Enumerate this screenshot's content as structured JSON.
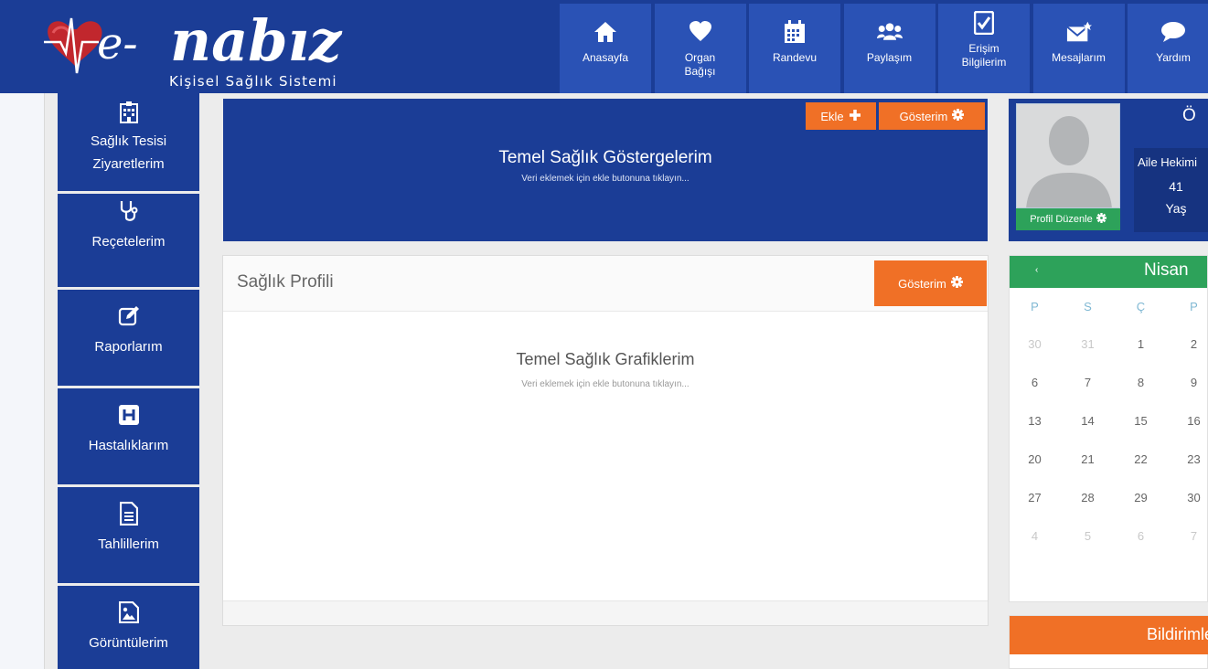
{
  "header": {
    "logo_text": "e-nabız",
    "logo_tagline": "Kişisel Sağlık Sistemi",
    "nav": [
      {
        "label": "Anasayfa",
        "icon": "home-icon"
      },
      {
        "label": "Organ Bağışı",
        "icon": "heart-icon"
      },
      {
        "label": "Randevu",
        "icon": "calendar-icon"
      },
      {
        "label": "Paylaşım",
        "icon": "users-icon"
      },
      {
        "label": "Erişim Bilgilerim",
        "icon": "checkbox-icon"
      },
      {
        "label": "Mesajlarım",
        "icon": "envelope-icon"
      },
      {
        "label": "Yardım",
        "icon": "chat-bubble-icon"
      }
    ]
  },
  "sidebar": {
    "items": [
      {
        "label": "Sağlık Tesisi Ziyaretlerim",
        "icon": "hospital-building-icon"
      },
      {
        "label": "Reçetelerim",
        "icon": "stethoscope-icon"
      },
      {
        "label": "Raporlarım",
        "icon": "edit-icon"
      },
      {
        "label": "Hastalıklarım",
        "icon": "h-square-icon"
      },
      {
        "label": "Tahlillerim",
        "icon": "document-icon"
      },
      {
        "label": "Görüntülerim",
        "icon": "image-icon"
      }
    ]
  },
  "temel": {
    "add_label": "Ekle",
    "view_label": "Gösterim",
    "title": "Temel Sağlık Göstergelerim",
    "subtitle": "Veri eklemek için ekle butonuna tıklayın..."
  },
  "profil": {
    "title": "Sağlık Profili",
    "view_label": "Gösterim",
    "graph_title": "Temel Sağlık Grafiklerim",
    "graph_subtitle": "Veri eklemek için ekle butonuna tıklayın..."
  },
  "user": {
    "initial": "Ö",
    "edit_label": "Profil Düzenle",
    "doctor_label": "Aile Hekimi",
    "age": "41",
    "age_label": "Yaş"
  },
  "calendar": {
    "prev": "‹",
    "month": "Nisan",
    "days_of_week": [
      "P",
      "S",
      "Ç",
      "P"
    ],
    "weeks": [
      [
        "30",
        "31",
        "1",
        "2"
      ],
      [
        "6",
        "7",
        "8",
        "9"
      ],
      [
        "13",
        "14",
        "15",
        "16"
      ],
      [
        "20",
        "21",
        "22",
        "23"
      ],
      [
        "27",
        "28",
        "29",
        "30"
      ],
      [
        "4",
        "5",
        "6",
        "7"
      ]
    ]
  },
  "notifications": {
    "title": "Bildirimler"
  },
  "colors": {
    "primary_blue": "#1b3d96",
    "nav_blue": "#2a52b5",
    "orange": "#f07026",
    "green": "#2da25a"
  }
}
